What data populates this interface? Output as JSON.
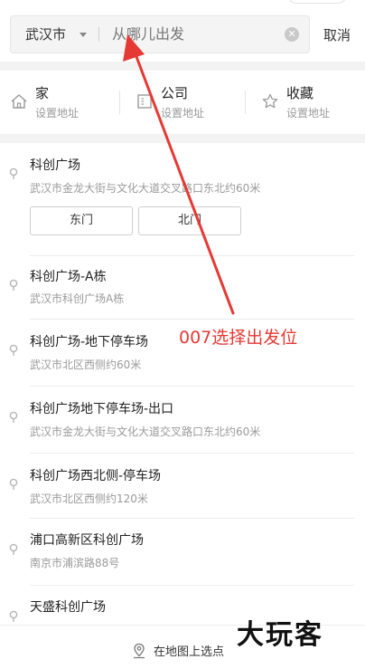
{
  "search": {
    "city": "武汉市",
    "placeholder": "从哪儿出发",
    "cancel_label": "取消"
  },
  "quick_access": [
    {
      "title": "家",
      "subtitle": "设置地址",
      "icon": "home-icon"
    },
    {
      "title": "公司",
      "subtitle": "设置地址",
      "icon": "office-icon"
    },
    {
      "title": "收藏",
      "subtitle": "设置地址",
      "icon": "star-icon"
    }
  ],
  "results": [
    {
      "name": "科创广场",
      "address": "武汉市金龙大街与文化大道交叉路口东北约60米",
      "sub_entrances": [
        "东门",
        "北门"
      ]
    },
    {
      "name": "科创广场-A栋",
      "address": "武汉市科创广场A栋"
    },
    {
      "name": "科创广场-地下停车场",
      "address": "武汉市北区西侧约60米"
    },
    {
      "name": "科创广场地下停车场-出口",
      "address": "武汉市金龙大街与文化大道交叉路口东北约60米"
    },
    {
      "name": "科创广场西北侧-停车场",
      "address": "武汉市北区西侧约120米"
    },
    {
      "name": "浦口高新区科创广场",
      "address": "南京市浦滨路88号"
    },
    {
      "name": "天盛科创广场",
      "address": ""
    }
  ],
  "annotation": {
    "text": "007选择出发位",
    "color": "#e53935"
  },
  "bottom": {
    "map_pick_label": "在地图上选点"
  },
  "watermark": {
    "text": "大玩客"
  }
}
